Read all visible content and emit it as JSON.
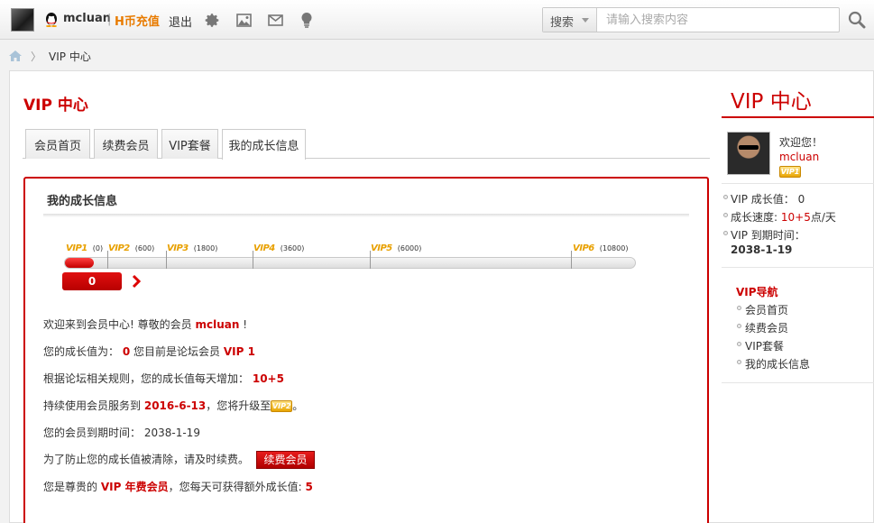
{
  "topbar": {
    "username": "mcluan",
    "separator": "|",
    "recharge": "H币充值",
    "logout": "退出",
    "search_select": "搜索",
    "search_placeholder": "请输入搜索内容"
  },
  "breadcrumb": {
    "current": "VIP 中心"
  },
  "main": {
    "title": "VIP 中心",
    "tabs": [
      {
        "label": "会员首页"
      },
      {
        "label": "续费会员"
      },
      {
        "label": "VIP套餐"
      },
      {
        "label": "我的成长信息"
      }
    ],
    "growth": {
      "title": "我的成长信息",
      "levels": [
        {
          "name": "VIP1",
          "points": "(0)"
        },
        {
          "name": "VIP2",
          "points": "(600)"
        },
        {
          "name": "VIP3",
          "points": "(1800)"
        },
        {
          "name": "VIP4",
          "points": "(3600)"
        },
        {
          "name": "VIP5",
          "points": "(6000)"
        },
        {
          "name": "VIP6",
          "points": "(10800)"
        }
      ],
      "current_value": "0",
      "lines": {
        "welcome_prefix": "欢迎来到会员中心! 尊敬的会员",
        "welcome_name": "mcluan",
        "welcome_suffix": "!",
        "growth_prefix": "您的成长值为：",
        "growth_value": "0",
        "growth_mid": "您目前是论坛会员",
        "growth_level": "VIP 1",
        "rule_prefix": "根据论坛相关规则，您的成长值每天增加：",
        "rule_value": "10+5",
        "upgrade_prefix": "持续使用会员服务到",
        "upgrade_date": "2016-6-13",
        "upgrade_mid": "，您将升级至",
        "upgrade_badge": "VIP2",
        "upgrade_suffix": "。",
        "expire_label": "您的会员到期时间：",
        "expire_date": "2038-1-19",
        "renew_prefix": "为了防止您的成长值被清除，请及时续费。",
        "renew_button": "续费会员",
        "annual_prefix": "您是尊贵的",
        "annual_level": "VIP 年费会员",
        "annual_mid": "，您每天可获得额外成长值:",
        "annual_value": "5"
      }
    }
  },
  "sidebar": {
    "title": "VIP 中心",
    "welcome": "欢迎您！",
    "username": "mcluan",
    "badge": "VIP1",
    "stats": {
      "growth_label": "VIP 成长值：",
      "growth_value": "0",
      "speed_label": "成长速度:",
      "speed_value": "10+5",
      "speed_unit": "点/天",
      "expire_label": "VIP 到期时间：",
      "expire_date": "2038-1-19"
    },
    "nav_title": "VIP导航",
    "nav": [
      {
        "label": "会员首页"
      },
      {
        "label": "续费会员"
      },
      {
        "label": "VIP套餐"
      },
      {
        "label": "我的成长信息"
      }
    ]
  }
}
